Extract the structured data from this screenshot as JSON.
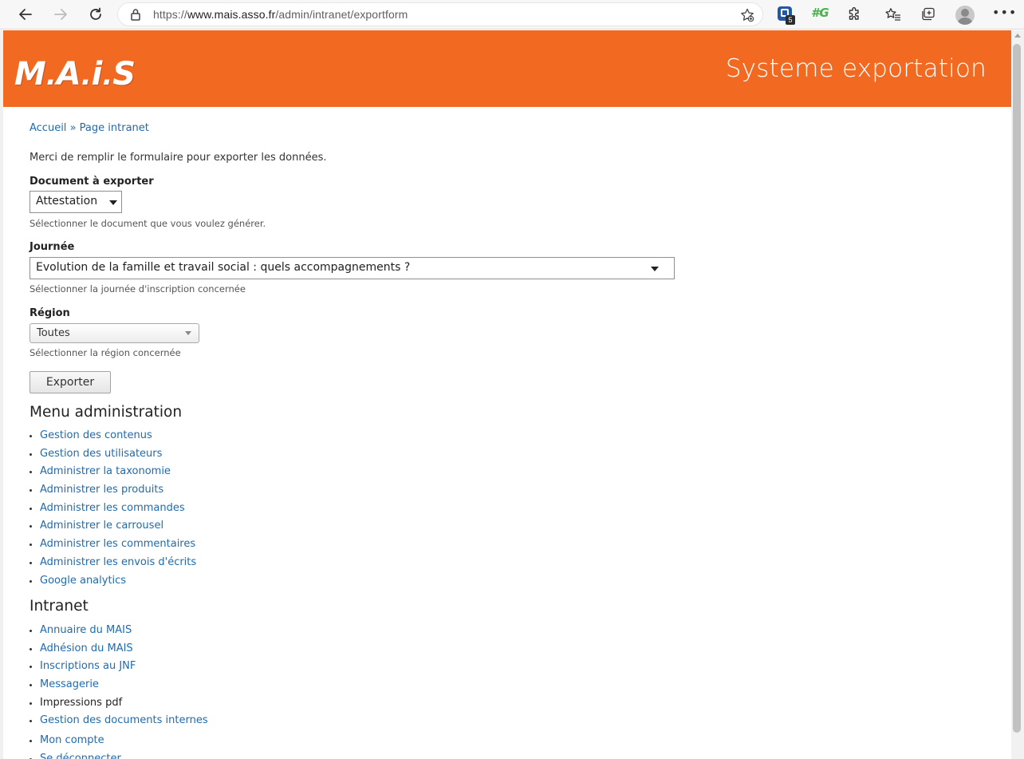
{
  "browser": {
    "url_prefix": "https://",
    "url_host": "www.mais.asso.fr",
    "url_path": "/admin/intranet/exportform",
    "extension_badge_count": "5",
    "grammar_ext": "#G"
  },
  "banner": {
    "logo_parts": [
      "M",
      "A",
      "i",
      "S"
    ],
    "title": "Systeme exportation",
    "colors": {
      "background": "#f26a22",
      "text": "#ffffff"
    }
  },
  "breadcrumb": {
    "items": [
      {
        "label": "Accueil"
      },
      {
        "label": "Page intranet"
      }
    ],
    "separator": "»"
  },
  "form": {
    "intro": "Merci de remplir le formulaire pour exporter les données.",
    "document": {
      "label": "Document à exporter",
      "value": "Attestation",
      "help": "Sélectionner le document que vous voulez générer."
    },
    "journee": {
      "label": "Journée",
      "value": "Evolution de la famille et travail social : quels accompagnements ?",
      "help": "Sélectionner la journée d'inscription concernée"
    },
    "region": {
      "label": "Région",
      "value": "Toutes",
      "help": "Sélectionner la région concernée"
    },
    "submit_label": "Exporter"
  },
  "admin_menu": {
    "title": "Menu administration",
    "items": [
      {
        "label": "Gestion des contenus",
        "link": true
      },
      {
        "label": "Gestion des utilisateurs",
        "link": true
      },
      {
        "label": "Administrer la taxonomie",
        "link": true
      },
      {
        "label": "Administrer les produits",
        "link": true
      },
      {
        "label": "Administrer les commandes",
        "link": true
      },
      {
        "label": "Administrer le carrousel",
        "link": true
      },
      {
        "label": "Administrer les commentaires",
        "link": true
      },
      {
        "label": "Administrer les envois d'écrits",
        "link": true
      },
      {
        "label": "Google analytics",
        "link": true
      }
    ]
  },
  "intranet": {
    "title": "Intranet",
    "items": [
      {
        "label": "Annuaire du MAIS",
        "link": true
      },
      {
        "label": "Adhésion du MAIS",
        "link": true
      },
      {
        "label": "Inscriptions au JNF",
        "link": true
      },
      {
        "label": "Messagerie",
        "link": true
      },
      {
        "label": "Impressions pdf",
        "link": false
      },
      {
        "label": "Gestion des documents internes",
        "link": true
      }
    ],
    "account_items": [
      {
        "label": "Mon compte",
        "link": true
      },
      {
        "label": "Se déconnecter",
        "link": true
      }
    ]
  },
  "colors": {
    "link": "#1f6bb0",
    "text": "#222222"
  }
}
